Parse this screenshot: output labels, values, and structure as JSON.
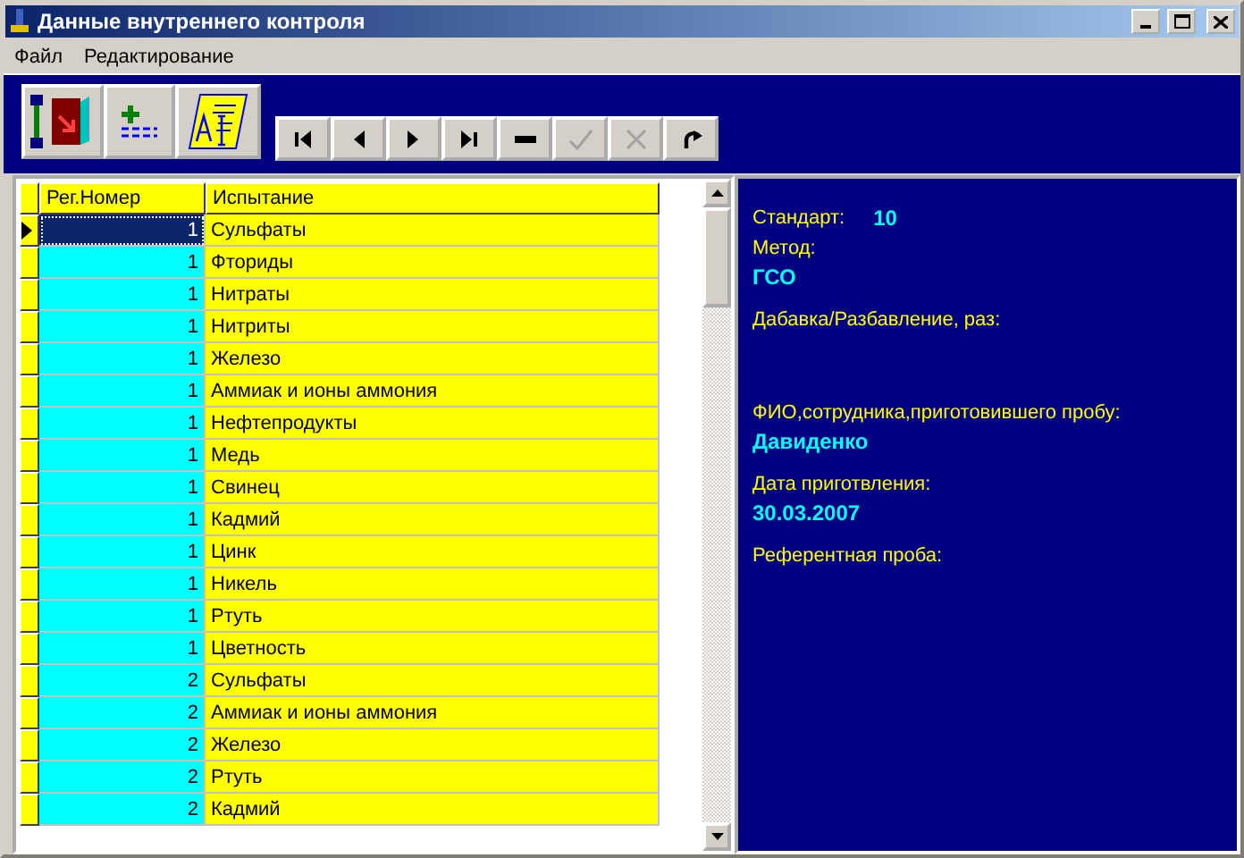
{
  "window": {
    "title": "Данные внутреннего контроля"
  },
  "menu": [
    "Файл",
    "Редактирование"
  ],
  "toolbar": [
    {
      "kind": "exit"
    },
    {
      "kind": "add"
    },
    {
      "kind": "edit"
    }
  ],
  "navigator": [
    {
      "kind": "first",
      "disabled": false
    },
    {
      "kind": "prior",
      "disabled": false
    },
    {
      "kind": "next",
      "disabled": false
    },
    {
      "kind": "last",
      "disabled": false
    },
    {
      "kind": "delete",
      "disabled": false
    },
    {
      "kind": "post",
      "disabled": true
    },
    {
      "kind": "cancel",
      "disabled": true
    },
    {
      "kind": "refresh",
      "disabled": false
    }
  ],
  "table": {
    "columns": [
      "Рег.Номер",
      "Испытание"
    ],
    "rows": [
      {
        "reg": "1",
        "test": "Сульфаты",
        "selected": true
      },
      {
        "reg": "1",
        "test": "Фториды",
        "selected": false
      },
      {
        "reg": "1",
        "test": "Нитраты",
        "selected": false
      },
      {
        "reg": "1",
        "test": "Нитриты",
        "selected": false
      },
      {
        "reg": "1",
        "test": "Железо",
        "selected": false
      },
      {
        "reg": "1",
        "test": "Аммиак и ионы аммония",
        "selected": false
      },
      {
        "reg": "1",
        "test": "Нефтепродукты",
        "selected": false
      },
      {
        "reg": "1",
        "test": "Медь",
        "selected": false
      },
      {
        "reg": "1",
        "test": "Свинец",
        "selected": false
      },
      {
        "reg": "1",
        "test": "Кадмий",
        "selected": false
      },
      {
        "reg": "1",
        "test": "Цинк",
        "selected": false
      },
      {
        "reg": "1",
        "test": "Никель",
        "selected": false
      },
      {
        "reg": "1",
        "test": "Ртуть",
        "selected": false
      },
      {
        "reg": "1",
        "test": "Цветность",
        "selected": false
      },
      {
        "reg": "2",
        "test": "Сульфаты",
        "selected": false
      },
      {
        "reg": "2",
        "test": "Аммиак и ионы аммония",
        "selected": false
      },
      {
        "reg": "2",
        "test": "Железо",
        "selected": false
      },
      {
        "reg": "2",
        "test": "Ртуть",
        "selected": false
      },
      {
        "reg": "2",
        "test": "Кадмий",
        "selected": false
      }
    ]
  },
  "details": [
    {
      "kind": "inline",
      "label": "Стандарт:",
      "value": "10"
    },
    {
      "kind": "stacked",
      "label": "Метод:",
      "value": "ГСО"
    },
    {
      "kind": "empty",
      "label": "Дабавка/Разбавление, раз:"
    },
    {
      "kind": "stacked",
      "label": "ФИО,сотрудника,приготовившего пробу:",
      "value": "Давиденко"
    },
    {
      "kind": "stacked",
      "label": "Дата приготвления:",
      "value": "30.03.2007"
    },
    {
      "kind": "empty",
      "label": "Референтная проба:"
    }
  ]
}
